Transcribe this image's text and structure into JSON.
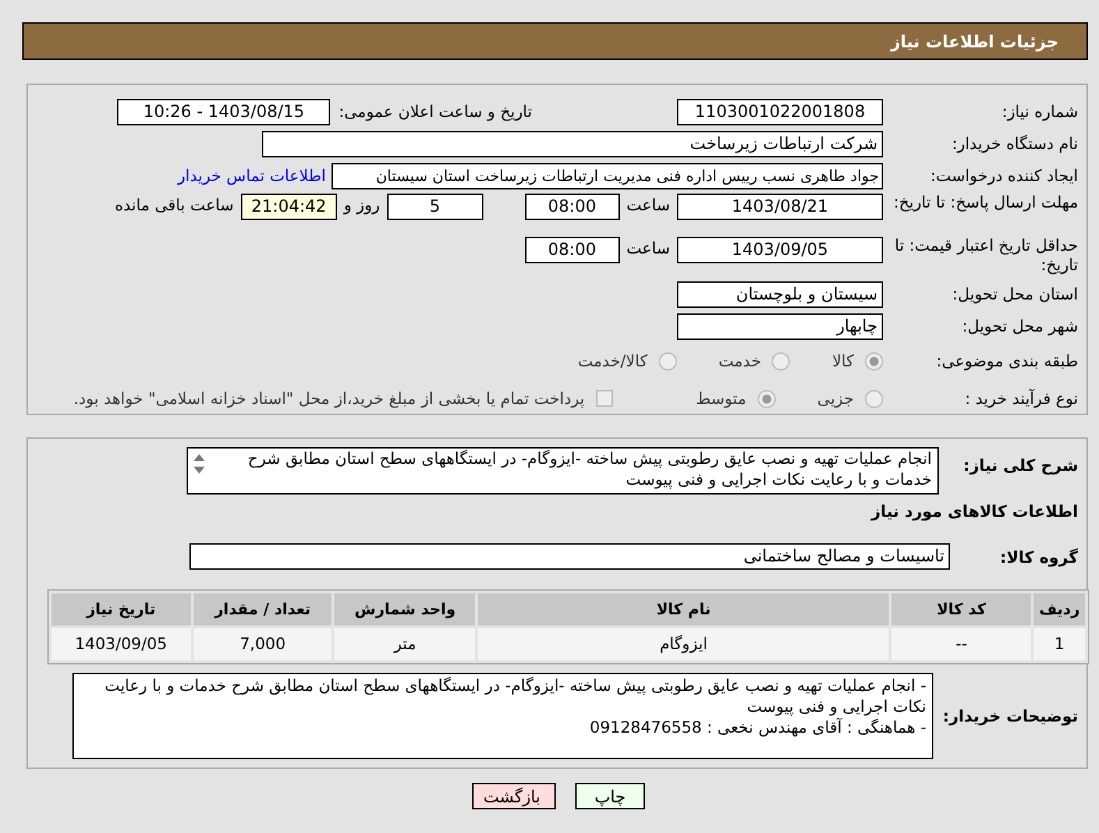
{
  "header": {
    "title": "جزئیات اطلاعات نیاز"
  },
  "need_number": {
    "label": "شماره نیاز:",
    "value": "1103001022001808"
  },
  "announce": {
    "label": "تاریخ و ساعت اعلان عمومی:",
    "value": "1403/08/15 - 10:26"
  },
  "buyer_org": {
    "label": "نام دستگاه خریدار:",
    "value": "شرکت ارتباطات زیرساخت"
  },
  "requester": {
    "label": "ایجاد کننده درخواست:",
    "value": "جواد طاهری نسب رییس اداره فنی مدیریت ارتباطات زیرساخت استان سیستان",
    "link": "اطلاعات تماس خریدار"
  },
  "deadline": {
    "label": "مهلت ارسال پاسخ: تا تاریخ:",
    "date": "1403/08/21",
    "time_label": "ساعت",
    "time": "08:00",
    "days": "5",
    "days_label": "روز و",
    "remaining": "21:04:42",
    "remaining_label": "ساعت باقی مانده"
  },
  "price_validity": {
    "label": "حداقل تاریخ اعتبار قیمت: تا تاریخ:",
    "date": "1403/09/05",
    "time_label": "ساعت",
    "time": "08:00"
  },
  "province": {
    "label": "استان محل تحویل:",
    "value": "سیستان و بلوچستان"
  },
  "city": {
    "label": "شهر محل تحویل:",
    "value": "چابهار"
  },
  "category": {
    "label": "طبقه بندی موضوعی:",
    "options": [
      {
        "label": "كالا",
        "selected": true
      },
      {
        "label": "خدمت",
        "selected": false
      },
      {
        "label": "كالا/خدمت",
        "selected": false
      }
    ]
  },
  "purchase_type": {
    "label": "نوع فرآیند خرید :",
    "options": [
      {
        "kind": "radio",
        "label": "جزیی",
        "selected": false
      },
      {
        "kind": "radio",
        "label": "متوسط",
        "selected": true
      },
      {
        "kind": "checkbox",
        "label": "پرداخت تمام یا بخشی از مبلغ خرید،از محل \"اسناد خزانه اسلامی\" خواهد بود.",
        "selected": false
      }
    ]
  },
  "summary": {
    "label": "شرح کلی نیاز:",
    "value": "انجام عملیات تهیه و نصب عایق رطوبتی پیش ساخته -ایزوگام- در ایستگاههای سطح استان مطابق شرح خدمات و با رعایت نکات اجرایی و فنی پیوست"
  },
  "goods_heading": "اطلاعات کالاهای مورد نیاز",
  "goods_group": {
    "label": "گروه کالا:",
    "value": "تاسیسات و مصالح ساختمانی"
  },
  "table": {
    "columns": [
      "ردیف",
      "کد کالا",
      "نام کالا",
      "واحد شمارش",
      "تعداد / مقدار",
      "تاریخ نیاز"
    ],
    "rows": [
      [
        "1",
        "--",
        "ایزوگام",
        "متر",
        "7,000",
        "1403/09/05"
      ]
    ]
  },
  "buyer_notes": {
    "label": "توضیحات خریدار:",
    "lines": [
      "- انجام عملیات تهیه و نصب عایق رطوبتی پیش ساخته -ایزوگام- در ایستگاههای سطح استان مطابق شرح خدمات و با رعایت نکات اجرایی و فنی پیوست",
      "- هماهنگی : آقای مهندس نخعی : 09128476558"
    ]
  },
  "buttons": [
    {
      "kind": "print",
      "label": "چاپ"
    },
    {
      "kind": "back",
      "label": "بازگشت"
    }
  ]
}
